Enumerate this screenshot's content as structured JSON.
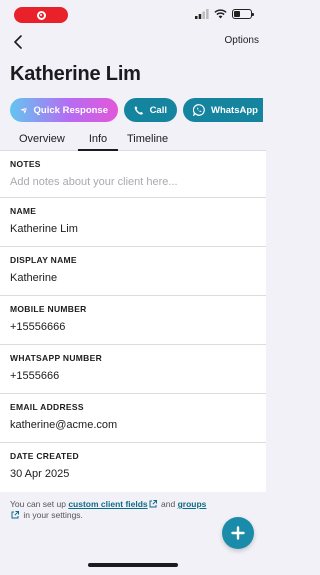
{
  "header": {
    "options_label": "Options",
    "client_name": "Katherine Lim"
  },
  "actions": {
    "quick_response": "Quick Response",
    "call": "Call",
    "whatsapp": "WhatsApp"
  },
  "tabs": [
    {
      "label": "Overview",
      "active": false
    },
    {
      "label": "Info",
      "active": true
    },
    {
      "label": "Timeline",
      "active": false
    }
  ],
  "fields": {
    "notes": {
      "label": "NOTES",
      "value": "",
      "placeholder": "Add notes about your client here..."
    },
    "name": {
      "label": "NAME",
      "value": "Katherine Lim"
    },
    "display_name": {
      "label": "DISPLAY NAME",
      "value": "Katherine"
    },
    "mobile_number": {
      "label": "MOBILE NUMBER",
      "value": "+15556666"
    },
    "whatsapp_number": {
      "label": "WHATSAPP NUMBER",
      "value": "+1555666"
    },
    "email_address": {
      "label": "EMAIL ADDRESS",
      "value": "katherine@acme.com"
    },
    "date_created": {
      "label": "DATE CREATED",
      "value": "30 Apr 2025"
    }
  },
  "footer": {
    "text_before": "You can set up",
    "link_custom_fields": "custom client fields",
    "text_and": "and",
    "link_groups": "groups",
    "text_after": "in your settings."
  },
  "status_bar": {
    "battery_level": 0.35
  },
  "colors": {
    "teal": "#15849f",
    "recording_red": "#e8212a",
    "link": "#0e6b86"
  },
  "icons": [
    "recording-icon",
    "signal-icon",
    "wifi-icon",
    "battery-icon",
    "back-chevron-icon",
    "send-icon",
    "phone-icon",
    "whatsapp-icon",
    "external-link-icon",
    "plus-icon"
  ]
}
